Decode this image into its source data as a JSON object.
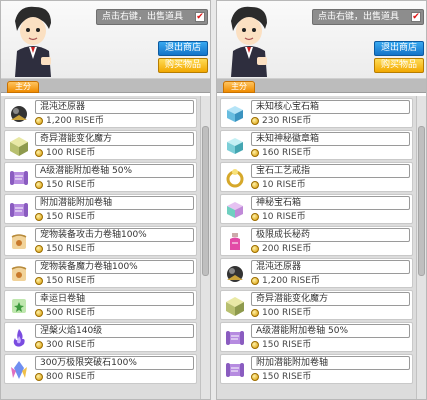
{
  "shop": {
    "checkbox_label": "点击右键，出售道具",
    "exit_label": "退出商店",
    "buy_label": "购买物品",
    "tab_label": "主分"
  },
  "left_items": [
    {
      "name": "混沌还原器",
      "price": "1,200 RISE币",
      "icon": "dark-orb-icon"
    },
    {
      "name": "奇异潜能变化魔方",
      "price": "100 RISE币",
      "icon": "cube-icon"
    },
    {
      "name": "A级潜能附加卷轴 50%",
      "price": "150 RISE币",
      "icon": "scroll-icon"
    },
    {
      "name": "附加潜能附加卷轴",
      "price": "150 RISE币",
      "icon": "scroll-icon"
    },
    {
      "name": "宠物装备攻击力卷轴100%",
      "price": "150 RISE币",
      "icon": "pet-scroll-icon"
    },
    {
      "name": "宠物装备魔力卷轴100%",
      "price": "150 RISE币",
      "icon": "pet-scroll-icon"
    },
    {
      "name": "幸运日卷轴",
      "price": "500 RISE币",
      "icon": "lucky-scroll-icon"
    },
    {
      "name": "涅槃火焰140级",
      "price": "300 RISE币",
      "icon": "flame-icon"
    },
    {
      "name": "300万极限突破石100%",
      "price": "800 RISE币",
      "icon": "crystal-icon"
    }
  ],
  "right_items": [
    {
      "name": "未知核心宝石箱",
      "price": "230 RISE币",
      "icon": "gem-box-icon"
    },
    {
      "name": "未知神秘徽章箱",
      "price": "160 RISE币",
      "icon": "badge-box-icon"
    },
    {
      "name": "宝石工艺戒指",
      "price": "10 RISE币",
      "icon": "ring-icon"
    },
    {
      "name": "神秘宝石箱",
      "price": "10 RISE币",
      "icon": "mystery-box-icon"
    },
    {
      "name": "极限成长秘药",
      "price": "200 RISE币",
      "icon": "potion-icon"
    },
    {
      "name": "混沌还原器",
      "price": "1,200 RISE币",
      "icon": "dark-orb-icon"
    },
    {
      "name": "奇异潜能变化魔方",
      "price": "100 RISE币",
      "icon": "cube-icon"
    },
    {
      "name": "A级潜能附加卷轴 50%",
      "price": "150 RISE币",
      "icon": "scroll-icon"
    },
    {
      "name": "附加潜能附加卷轴",
      "price": "150 RISE币",
      "icon": "scroll-icon"
    }
  ],
  "colors": {
    "exit_button": "#1e88d8",
    "buy_button": "#f5b000",
    "tab": "#f29500"
  }
}
